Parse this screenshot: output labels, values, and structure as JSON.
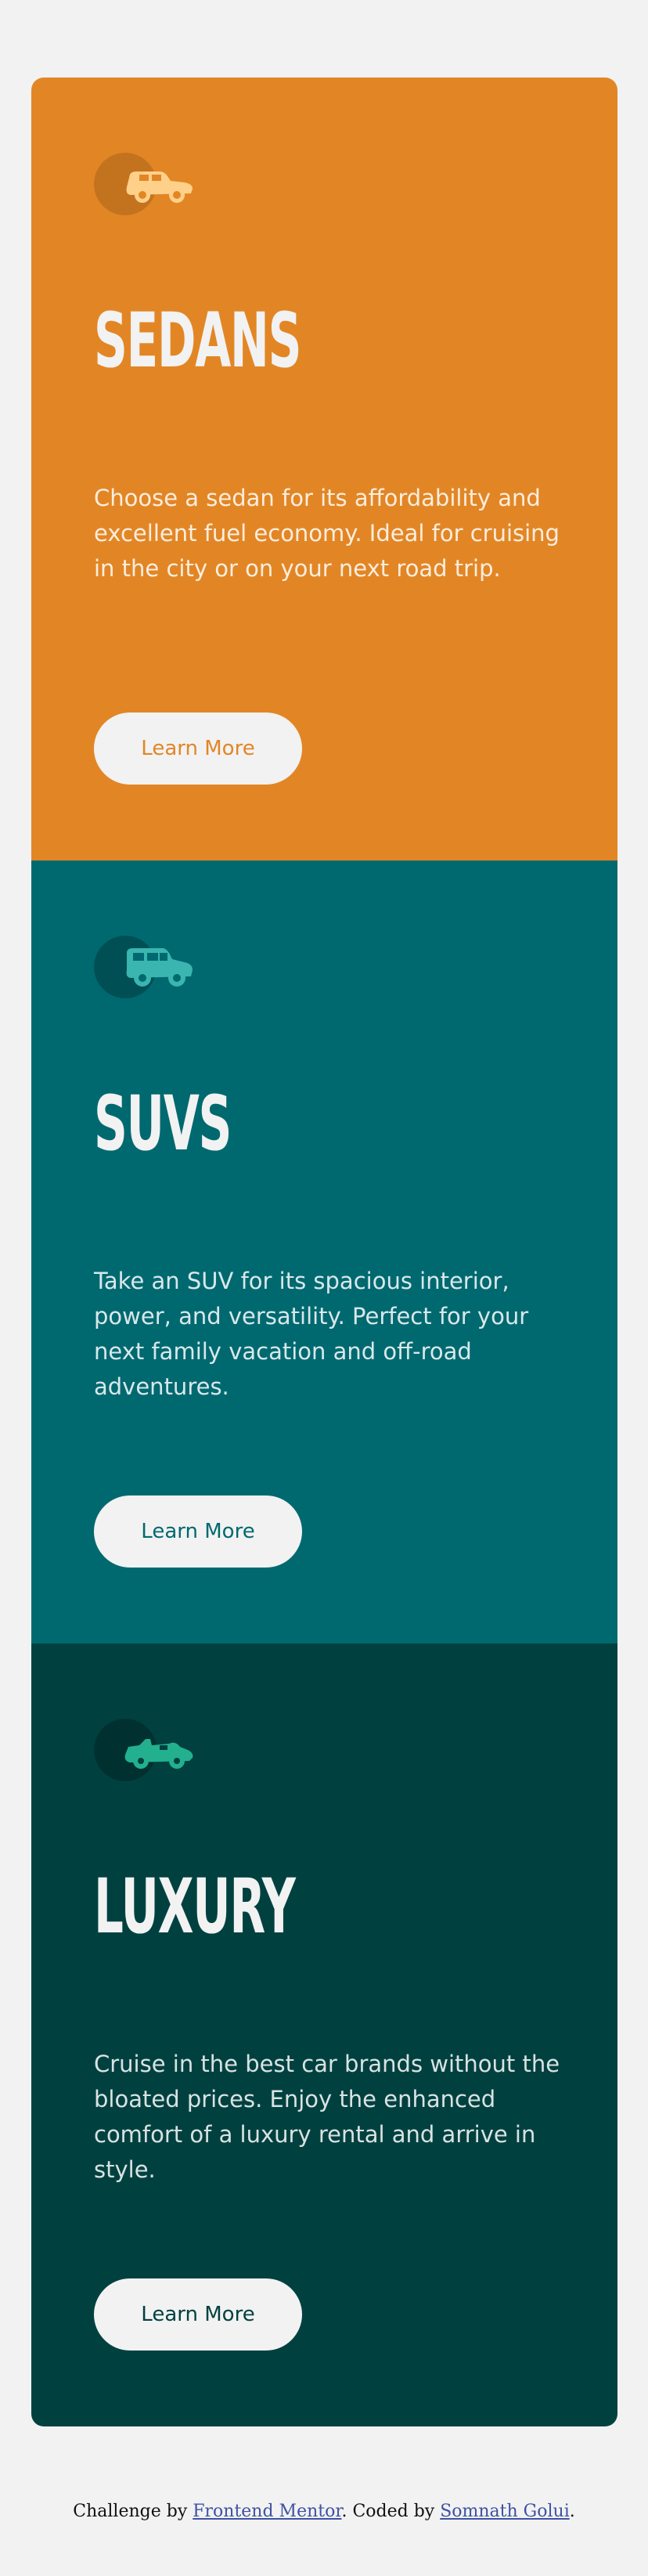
{
  "cards": [
    {
      "title": "SEDANS",
      "description": "Choose a sedan for its affordability and excellent fuel economy. Ideal for cruising in the city or on your next road trip.",
      "button_label": "Learn More",
      "icon": "sedan-car-icon",
      "bg_color": "#e28625"
    },
    {
      "title": "SUVS",
      "description": "Take an SUV for its spacious interior, power, and versatility. Perfect for your next family vacation and off-road adventures.",
      "button_label": "Learn More",
      "icon": "suv-car-icon",
      "bg_color": "#006970"
    },
    {
      "title": "LUXURY",
      "description": "Cruise in the best car brands without the bloated prices. Enjoy the enhanced comfort of a luxury rental and arrive in style.",
      "button_label": "Learn More",
      "icon": "luxury-car-icon",
      "bg_color": "#004140"
    }
  ],
  "attribution": {
    "prefix": "Challenge by ",
    "link1": "Frontend Mentor",
    "middle": ". Coded by ",
    "link2": "Somnath Golui",
    "suffix": "."
  },
  "colors": {
    "page_bg": "#f2f2f2",
    "link": "#3e52a3"
  }
}
